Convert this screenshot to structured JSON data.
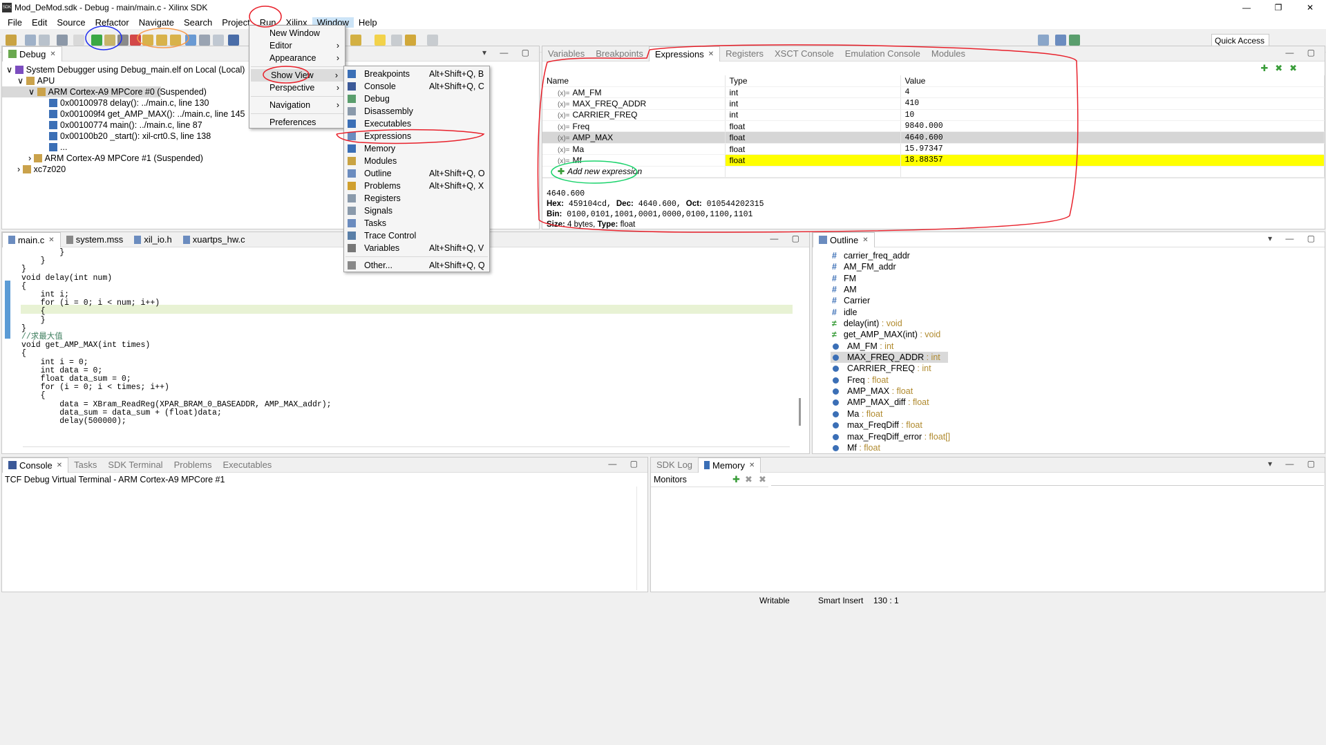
{
  "window": {
    "title": "Mod_DeMod.sdk - Debug - main/main.c - Xilinx SDK",
    "app_icon_text": "SDK"
  },
  "menubar": [
    "File",
    "Edit",
    "Source",
    "Refactor",
    "Navigate",
    "Search",
    "Project",
    "Run",
    "Xilinx",
    "Window",
    "Help"
  ],
  "quick_access": "Quick Access",
  "debug_view": {
    "tab": "Debug",
    "items": [
      "System Debugger using Debug_main.elf on Local (Local)",
      "APU",
      "ARM Cortex-A9 MPCore #0 (Suspended)",
      "0x00100978 delay(): ../main.c, line 130",
      "0x001009f4 get_AMP_MAX(): ../main.c, line 145",
      "0x00100774 main(): ../main.c, line 87",
      "0x00100b20 _start(): xil-crt0.S, line 138",
      "...",
      "ARM Cortex-A9 MPCore #1 (Suspended)",
      "xc7z020"
    ]
  },
  "window_menu": [
    "New Window",
    "Editor",
    "Appearance",
    "Show View",
    "Perspective",
    "Navigation",
    "Preferences"
  ],
  "show_view_menu": [
    {
      "label": "Breakpoints",
      "shortcut": "Alt+Shift+Q, B"
    },
    {
      "label": "Console",
      "shortcut": "Alt+Shift+Q, C"
    },
    {
      "label": "Debug",
      "shortcut": ""
    },
    {
      "label": "Disassembly",
      "shortcut": ""
    },
    {
      "label": "Executables",
      "shortcut": ""
    },
    {
      "label": "Expressions",
      "shortcut": ""
    },
    {
      "label": "Memory",
      "shortcut": ""
    },
    {
      "label": "Modules",
      "shortcut": ""
    },
    {
      "label": "Outline",
      "shortcut": "Alt+Shift+Q, O"
    },
    {
      "label": "Problems",
      "shortcut": "Alt+Shift+Q, X"
    },
    {
      "label": "Registers",
      "shortcut": ""
    },
    {
      "label": "Signals",
      "shortcut": ""
    },
    {
      "label": "Tasks",
      "shortcut": ""
    },
    {
      "label": "Trace Control",
      "shortcut": ""
    },
    {
      "label": "Variables",
      "shortcut": "Alt+Shift+Q, V"
    },
    {
      "label": "Other...",
      "shortcut": "Alt+Shift+Q, Q"
    }
  ],
  "right_tabs": [
    "Variables",
    "Breakpoints",
    "Expressions",
    "Registers",
    "XSCT Console",
    "Emulation Console",
    "Modules"
  ],
  "expressions": {
    "headers": [
      "Name",
      "Type",
      "Value"
    ],
    "rows": [
      {
        "name": "AM_FM",
        "type": "int",
        "value": "4"
      },
      {
        "name": "MAX_FREQ_ADDR",
        "type": "int",
        "value": "410"
      },
      {
        "name": "CARRIER_FREQ",
        "type": "int",
        "value": "10"
      },
      {
        "name": "Freq",
        "type": "float",
        "value": "9840.000"
      },
      {
        "name": "AMP_MAX",
        "type": "float",
        "value": "4640.600"
      },
      {
        "name": "Ma",
        "type": "float",
        "value": "15.97347"
      },
      {
        "name": "Mf",
        "type": "float",
        "value": "18.88357"
      }
    ],
    "add_new": "Add new expression",
    "detail_value": "4640.600",
    "hex_label": "Hex:",
    "hex": "459104cd,",
    "dec_label": "Dec:",
    "dec": "4640.600,",
    "oct_label": "Oct:",
    "oct": "010544202315",
    "bin_label": "Bin:",
    "bin": "0100,0101,1001,0001,0000,0100,1100,1101",
    "size_label": "Size:",
    "size": "4 bytes,",
    "type_label": "Type:",
    "type": "float"
  },
  "editor_tabs": [
    "main.c",
    "system.mss",
    "xil_io.h",
    "xuartps_hw.c"
  ],
  "code_lines": [
    "        }",
    "    }",
    "}",
    "",
    "void delay(int num)",
    "{",
    "    int i;",
    "    for (i = 0; i < num; i++)",
    "    {",
    "    }",
    "}",
    "//求最大值",
    "void get_AMP_MAX(int times)",
    "{",
    "    int i = 0;",
    "    int data = 0;",
    "    float data_sum = 0;",
    "",
    "    for (i = 0; i < times; i++)",
    "    {",
    "        data = XBram_ReadReg(XPAR_BRAM_0_BASEADDR, AMP_MAX_addr);",
    "        data_sum = data_sum + (float)data;",
    "        delay(500000);"
  ],
  "outline": {
    "tab": "Outline",
    "items": [
      {
        "kind": "hash",
        "name": "carrier_freq_addr",
        "type": ""
      },
      {
        "kind": "hash",
        "name": "AM_FM_addr",
        "type": ""
      },
      {
        "kind": "hash",
        "name": "FM",
        "type": ""
      },
      {
        "kind": "hash",
        "name": "AM",
        "type": ""
      },
      {
        "kind": "hash",
        "name": "Carrier",
        "type": ""
      },
      {
        "kind": "hash",
        "name": "idle",
        "type": ""
      },
      {
        "kind": "fn",
        "name": "delay(int)",
        "type": " : void"
      },
      {
        "kind": "fn",
        "name": "get_AMP_MAX(int)",
        "type": " : void"
      },
      {
        "kind": "var",
        "name": "AM_FM",
        "type": " : int"
      },
      {
        "kind": "var",
        "name": "MAX_FREQ_ADDR",
        "type": " : int"
      },
      {
        "kind": "var",
        "name": "CARRIER_FREQ",
        "type": " : int"
      },
      {
        "kind": "var",
        "name": "Freq",
        "type": " : float"
      },
      {
        "kind": "var",
        "name": "AMP_MAX",
        "type": " : float"
      },
      {
        "kind": "var",
        "name": "AMP_MAX_diff",
        "type": " : float"
      },
      {
        "kind": "var",
        "name": "Ma",
        "type": " : float"
      },
      {
        "kind": "var",
        "name": "max_FreqDiff",
        "type": " : float"
      },
      {
        "kind": "var",
        "name": "max_FreqDiff_error",
        "type": " : float[]"
      },
      {
        "kind": "var",
        "name": "Mf",
        "type": " : float"
      }
    ]
  },
  "console": {
    "tabs": [
      "Console",
      "Tasks",
      "SDK Terminal",
      "Problems",
      "Executables"
    ],
    "title": "TCF Debug Virtual Terminal - ARM Cortex-A9 MPCore #1"
  },
  "memory": {
    "tabs": [
      "SDK Log",
      "Memory"
    ],
    "monitors": "Monitors"
  },
  "status": {
    "writable": "Writable",
    "insert": "Smart Insert",
    "position": "130 : 1"
  },
  "colors": {
    "highlight_yellow": "#ffff00",
    "selected_row": "#d6d6d6",
    "annotation_red": "#e8202a",
    "annotation_blue": "#1e2cf0",
    "annotation_orange": "#f79a4a",
    "annotation_green": "#19d36b"
  }
}
